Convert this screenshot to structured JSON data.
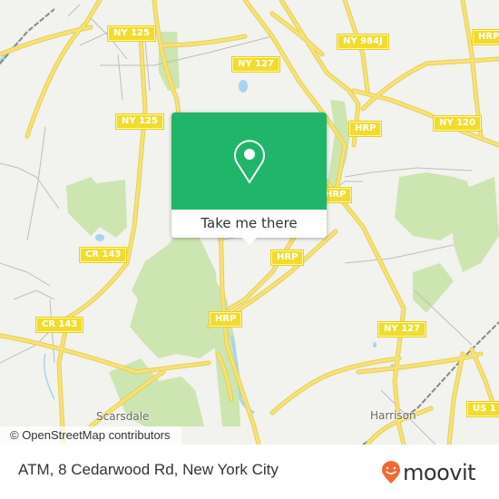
{
  "map": {
    "road_labels": [
      {
        "id": "ny125-top",
        "text": "NY 125"
      },
      {
        "id": "ny125-mid",
        "text": "NY 125"
      },
      {
        "id": "ny127-top",
        "text": "NY 127"
      },
      {
        "id": "ny984j",
        "text": "NY 984J"
      },
      {
        "id": "hrp-top-right",
        "text": "HRP"
      },
      {
        "id": "hrp-top",
        "text": "HRP"
      },
      {
        "id": "ny120",
        "text": "NY 120"
      },
      {
        "id": "hrp-mid",
        "text": "HRP"
      },
      {
        "id": "hrp-center",
        "text": "HRP"
      },
      {
        "id": "hrp-lower",
        "text": "HRP"
      },
      {
        "id": "cr143-top",
        "text": "CR 143"
      },
      {
        "id": "cr143-bottom",
        "text": "CR 143"
      },
      {
        "id": "ny127-bottom",
        "text": "NY 127"
      },
      {
        "id": "us1",
        "text": "US 1"
      }
    ],
    "places": [
      {
        "id": "scarsdale",
        "text": "Scarsdale"
      },
      {
        "id": "harrison",
        "text": "Harrison"
      }
    ],
    "attribution": "© OpenStreetMap contributors",
    "colors": {
      "land": "#f2f2ee",
      "road": "#f6e27a",
      "road_casing": "#e8cf50",
      "park": "#cde5b0",
      "water": "#a9d3ef",
      "minor_road": "#bdbdbd"
    }
  },
  "popup": {
    "icon": "map-pin-icon",
    "button_label": "Take me there",
    "accent_color": "#1fb66a"
  },
  "footer": {
    "address": "ATM, 8 Cedarwood Rd, New York City",
    "brand": "moovit",
    "brand_color": "#f06a35"
  }
}
